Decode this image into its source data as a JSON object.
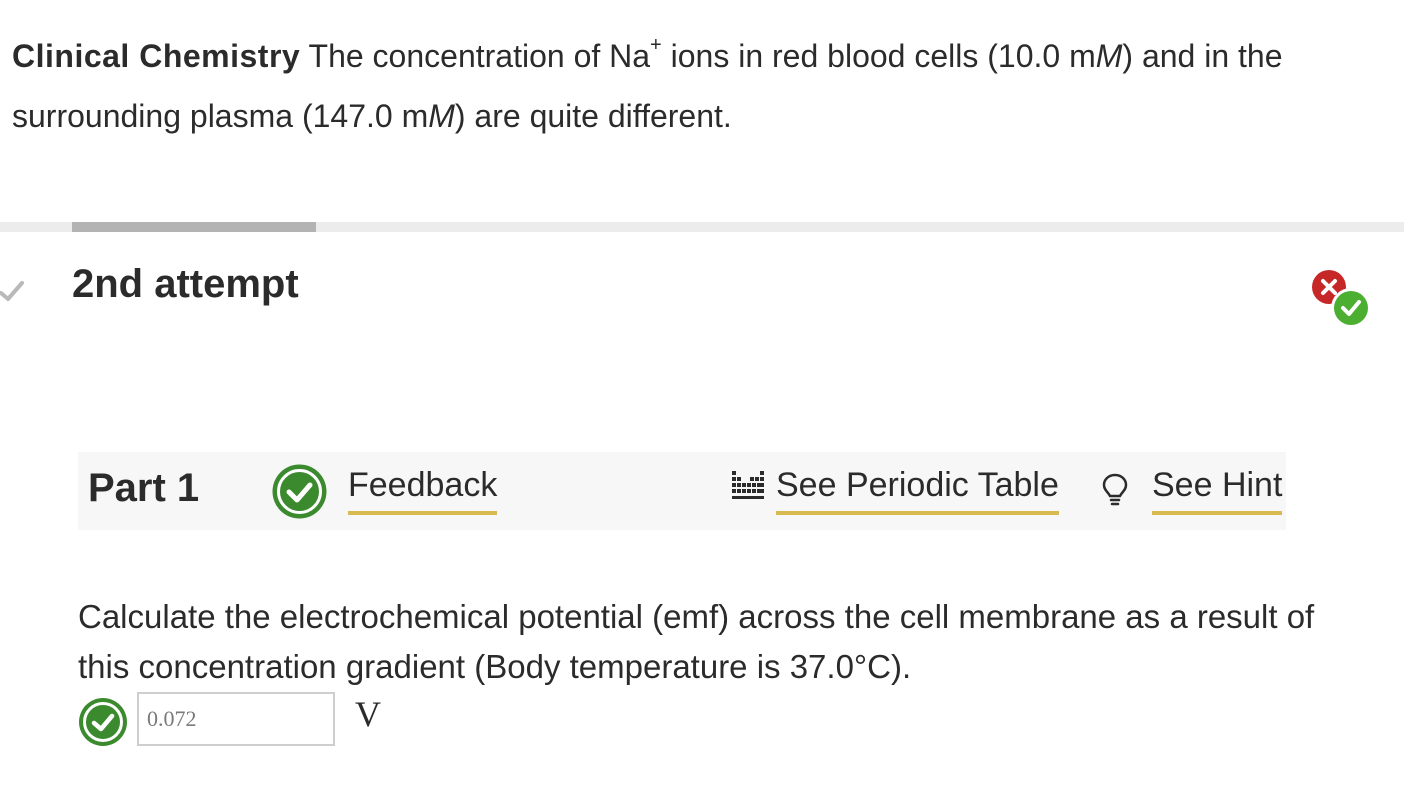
{
  "intro": {
    "lead": "Clinical Chemistry",
    "text_1": " The concentration of Na",
    "ion_charge": "+",
    "text_2": " ions in red blood cells (10.0 m",
    "unit_symbol_1": "M",
    "text_3": ") and in the surrounding plasma (147.0 m",
    "unit_symbol_2": "M",
    "text_4": ") are quite different."
  },
  "attempts": {
    "progress_fraction": 0.174,
    "title": "2nd attempt"
  },
  "part": {
    "label": "Part 1",
    "feedback_label": "Feedback",
    "periodic_table_label": "See Periodic Table",
    "hint_label": "See Hint"
  },
  "question": {
    "text": "Calculate the electrochemical potential (emf) across the cell membrane as a result of this concentration gradient (Body temperature is 37.0°C)."
  },
  "answer": {
    "value": "0.072",
    "unit": "V"
  },
  "colors": {
    "correct_green": "#3b8a2e",
    "incorrect_red": "#c62828",
    "link_underline": "#d7bb50",
    "progress_track": "#ececec",
    "progress_fill": "#b3b3b3"
  },
  "icons": {
    "previous_attempt": "checkmark-icon",
    "attempt_status": "incorrect-correct-status-icon",
    "part_status": "correct-check-icon",
    "periodic_table": "periodic-table-icon",
    "hint": "lightbulb-icon",
    "answer_status": "correct-check-icon"
  }
}
